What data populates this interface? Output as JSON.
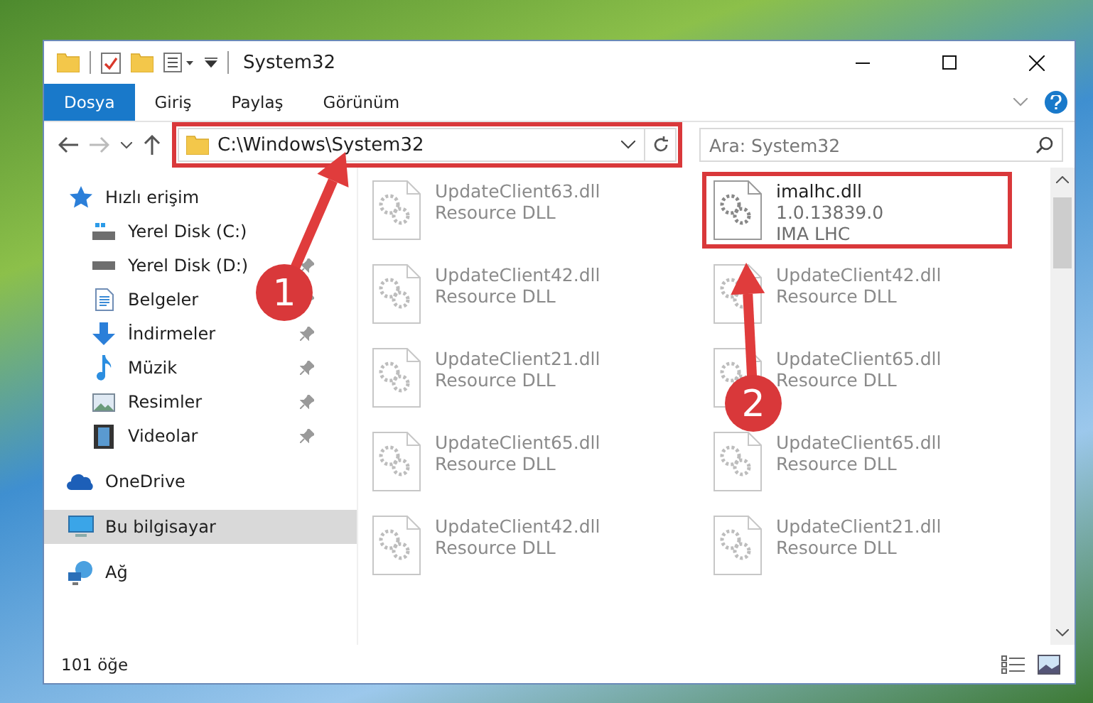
{
  "window": {
    "title": "System32"
  },
  "ribbon_tabs": [
    {
      "label": "Dosya",
      "selected": true
    },
    {
      "label": "Giriş",
      "selected": false
    },
    {
      "label": "Paylaş",
      "selected": false
    },
    {
      "label": "Görünüm",
      "selected": false
    }
  ],
  "address_bar": {
    "path": "C:\\Windows\\System32",
    "highlighted": true
  },
  "search": {
    "placeholder": "Ara: System32"
  },
  "sidebar": [
    {
      "label": "Hızlı erişim",
      "selected": false,
      "children": [
        {
          "label": "Yerel Disk (C:)",
          "pinned": false,
          "selected": false
        },
        {
          "label": "Yerel Disk (D:)",
          "pinned": true,
          "selected": false
        },
        {
          "label": "Belgeler",
          "pinned": true,
          "selected": false
        },
        {
          "label": "İndirmeler",
          "pinned": true,
          "selected": false
        },
        {
          "label": "Müzik",
          "pinned": true,
          "selected": false
        },
        {
          "label": "Resimler",
          "pinned": true,
          "selected": false
        },
        {
          "label": "Videolar",
          "pinned": true,
          "selected": false
        }
      ]
    },
    {
      "label": "OneDrive",
      "selected": false
    },
    {
      "label": "Bu bilgisayar",
      "selected": true
    },
    {
      "label": "Ağ",
      "selected": false
    }
  ],
  "files": [
    {
      "name": "UpdateClient63.dll",
      "details": [
        "Resource DLL"
      ],
      "blurred": true,
      "highlighted": false
    },
    {
      "name": "imalhc.dll",
      "details": [
        "1.0.13839.0",
        "IMA LHC"
      ],
      "blurred": false,
      "highlighted": true
    },
    {
      "name": "UpdateClient42.dll",
      "details": [
        "Resource DLL"
      ],
      "blurred": true,
      "highlighted": false
    },
    {
      "name": "UpdateClient42.dll",
      "details": [
        "Resource DLL"
      ],
      "blurred": true,
      "highlighted": false
    },
    {
      "name": "UpdateClient21.dll",
      "details": [
        "Resource DLL"
      ],
      "blurred": true,
      "highlighted": false
    },
    {
      "name": "UpdateClient65.dll",
      "details": [
        "Resource DLL"
      ],
      "blurred": true,
      "highlighted": false
    },
    {
      "name": "UpdateClient65.dll",
      "details": [
        "Resource DLL"
      ],
      "blurred": true,
      "highlighted": false
    },
    {
      "name": "UpdateClient65.dll",
      "details": [
        "Resource DLL"
      ],
      "blurred": true,
      "highlighted": false
    },
    {
      "name": "UpdateClient42.dll",
      "details": [
        "Resource DLL"
      ],
      "blurred": true,
      "highlighted": false
    },
    {
      "name": "UpdateClient21.dll",
      "details": [
        "Resource DLL"
      ],
      "blurred": true,
      "highlighted": false
    }
  ],
  "callouts": [
    {
      "number": "1"
    },
    {
      "number": "2"
    }
  ],
  "status_bar": {
    "item_count": "101 öğe"
  }
}
